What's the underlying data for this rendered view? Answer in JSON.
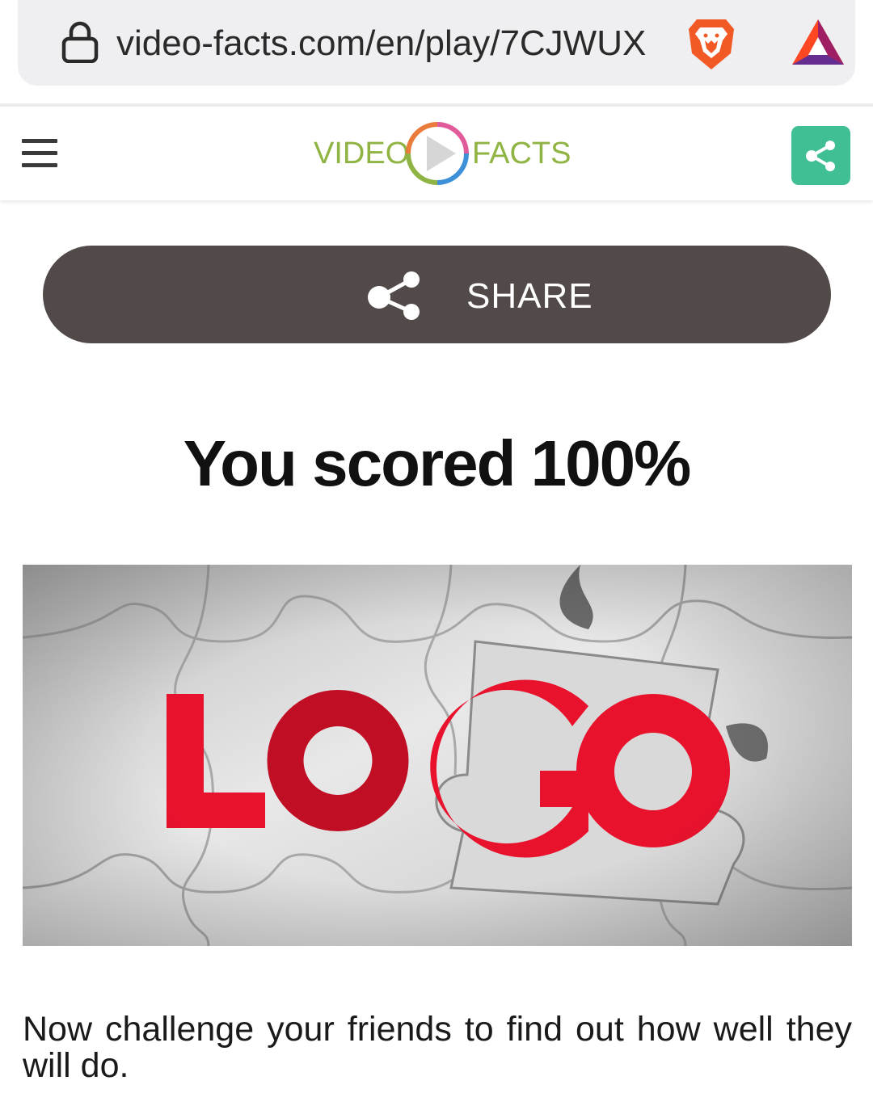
{
  "browser": {
    "url": "video-facts.com/en/play/7CJWUX",
    "lock_icon": "lock-icon",
    "brave_icon": "brave-lion-icon",
    "bat_icon": "bat-triangle-icon"
  },
  "header": {
    "menu_icon": "hamburger-menu-icon",
    "logo": {
      "left": "VIDEO",
      "right": "FACTS"
    },
    "share_icon": "share-icon"
  },
  "share_bar": {
    "label": "SHARE",
    "icon": "share-icon"
  },
  "result": {
    "title": "You scored 100%",
    "image_word": "LOGO",
    "challenge": "Now challenge your friends to find out how well they will do."
  },
  "colors": {
    "logo_green": "#8fb443",
    "header_share_bg": "#3fbf93",
    "share_bar_bg": "#514a48",
    "logo_red": "#e8122d"
  }
}
